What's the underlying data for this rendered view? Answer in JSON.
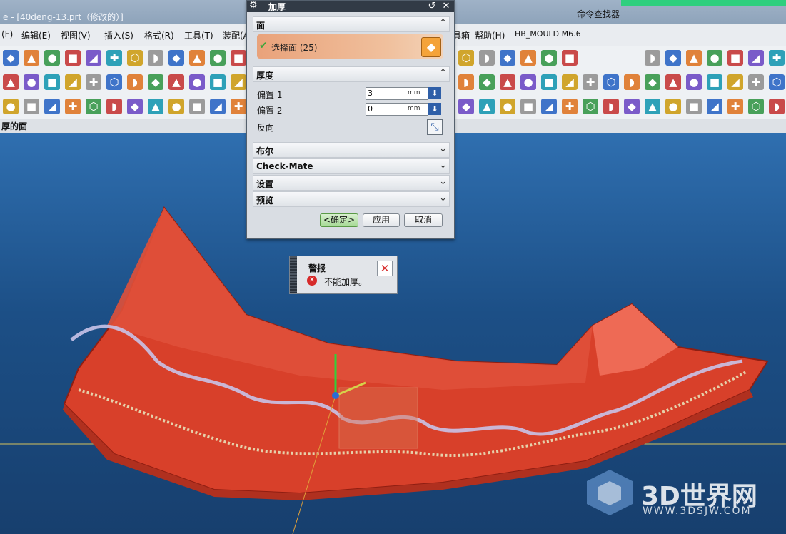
{
  "window": {
    "title": "e - [40deng-13.prt（修改的）]"
  },
  "menubar": [
    {
      "name": "file",
      "label": "(F)"
    },
    {
      "name": "edit",
      "label": "编辑(E)"
    },
    {
      "name": "view",
      "label": "视图(V)"
    },
    {
      "name": "insert",
      "label": "插入(S)"
    },
    {
      "name": "format",
      "label": "格式(R)"
    },
    {
      "name": "tools",
      "label": "工具(T)"
    },
    {
      "name": "assembly",
      "label": "装配(A"
    },
    {
      "name": "toolbox",
      "label": "具箱"
    },
    {
      "name": "help",
      "label": "帮助(H)"
    },
    {
      "name": "hb-mould",
      "label": "HB_MOULD M6.6"
    }
  ],
  "toolbar": {
    "command_finder_label": "命令查找器"
  },
  "statusbar": {
    "prompt": "厚的面"
  },
  "dialog": {
    "title": "加厚",
    "section_face": "面",
    "select_face_label": "选择面 (25)",
    "section_thickness": "厚度",
    "offset1_label": "偏置 1",
    "offset1_value": "3",
    "offset2_label": "偏置 2",
    "offset2_value": "0",
    "unit": "mm",
    "reverse_label": "反向",
    "section_boolean": "布尔",
    "section_checkmate": "Check-Mate",
    "section_settings": "设置",
    "section_preview": "预览",
    "ok_label": "<确定>",
    "apply_label": "应用",
    "cancel_label": "取消"
  },
  "alert": {
    "title": "警报",
    "message": "不能加厚。"
  },
  "watermark": {
    "brand": "3D世界网",
    "url": "WWW.3DSJW.COM"
  },
  "colors": {
    "model": "#d8402a",
    "accent": "#f4a33a"
  }
}
